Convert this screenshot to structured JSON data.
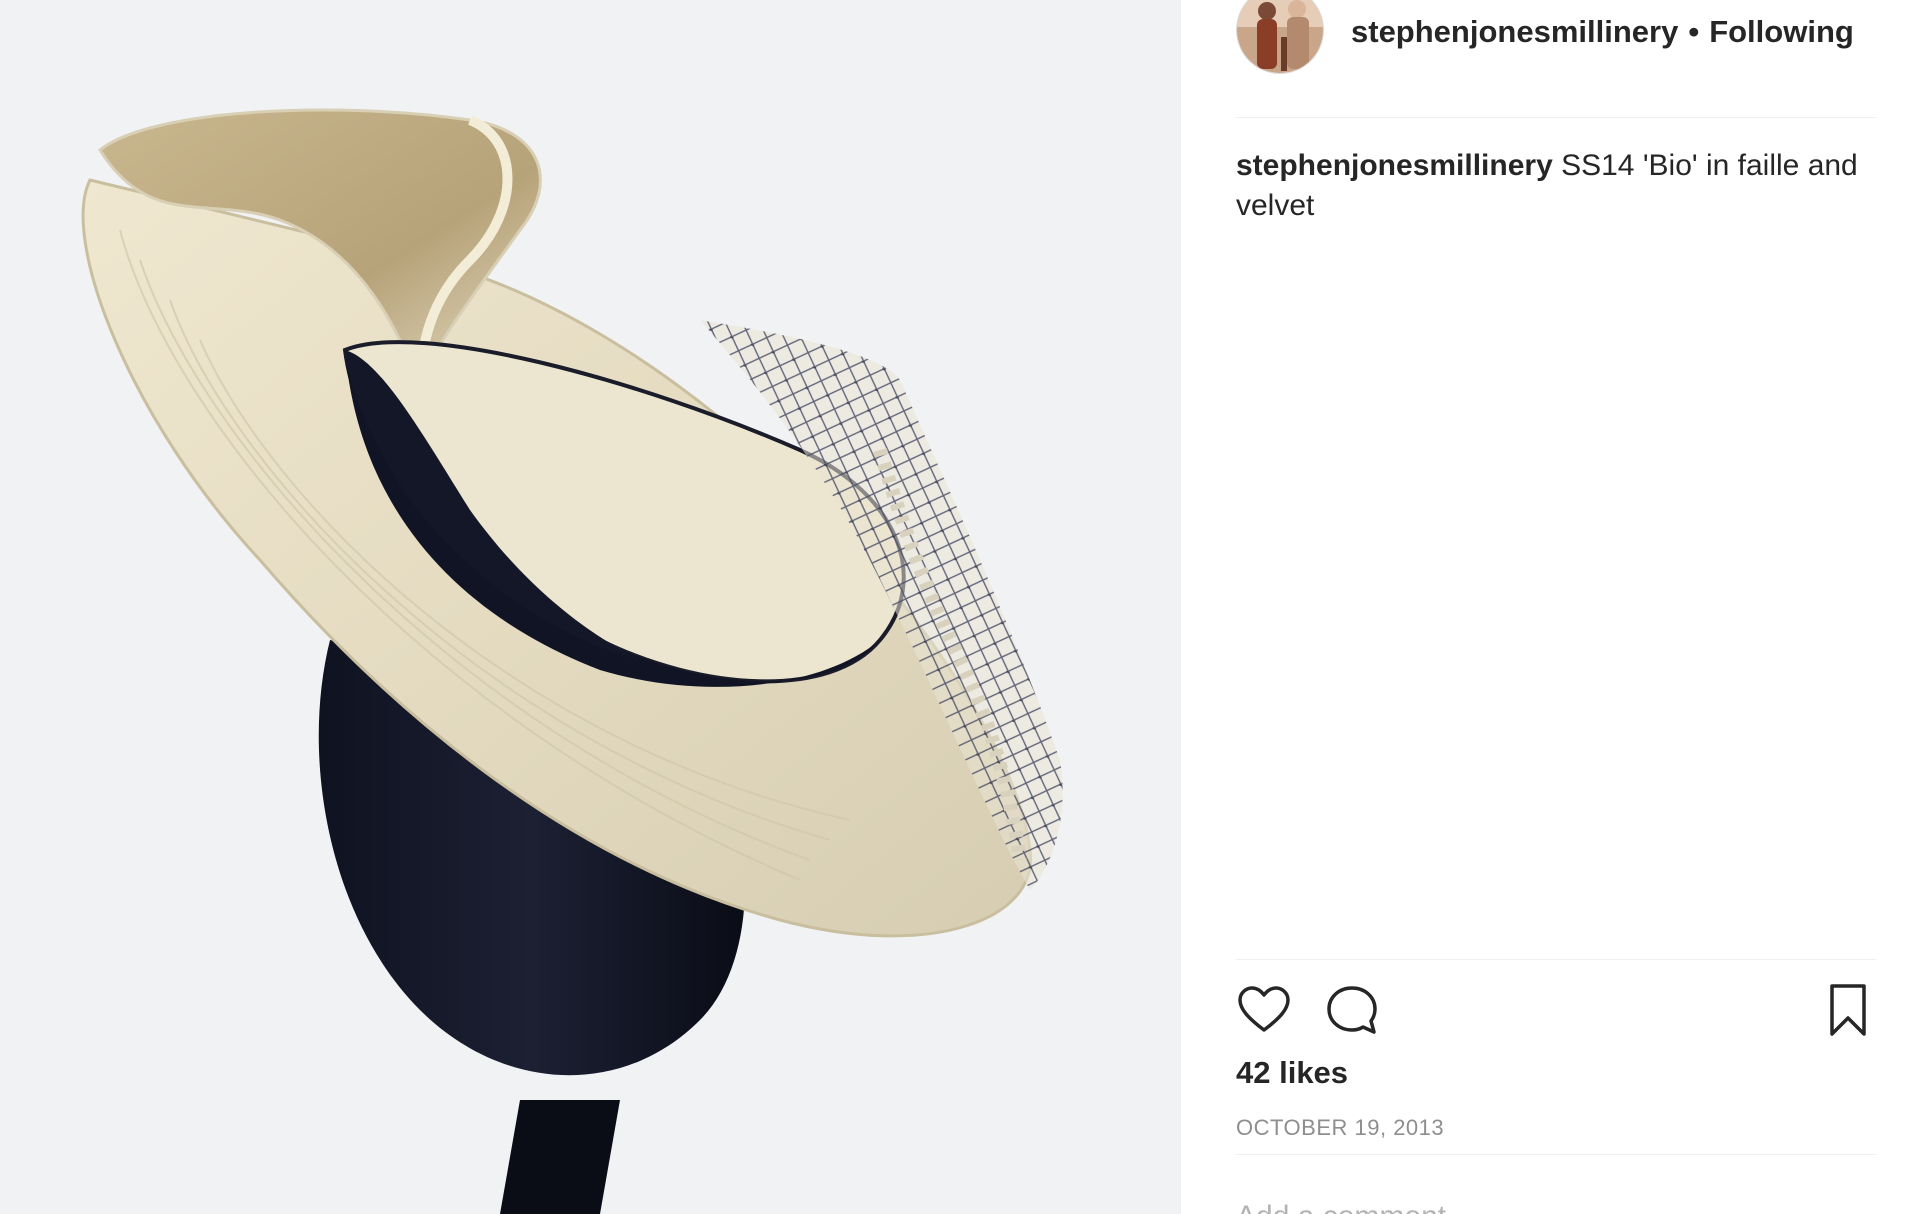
{
  "post": {
    "username": "stephenjonesmillinery",
    "separator": "•",
    "follow_status": "Following",
    "caption_user": "stephenjonesmillinery",
    "caption_text": " SS14 'Bio' in faille and velvet",
    "likes": "42 likes",
    "date": "OCTOBER 19, 2013",
    "comment_placeholder": "Add a comment..."
  },
  "icons": {
    "like": "heart-icon",
    "comment": "comment-bubble-icon",
    "save": "bookmark-icon"
  },
  "colors": {
    "text": "#262626",
    "muted": "#8e8e8e",
    "divider": "#efefef",
    "photo_background": "#f1f2f4"
  }
}
